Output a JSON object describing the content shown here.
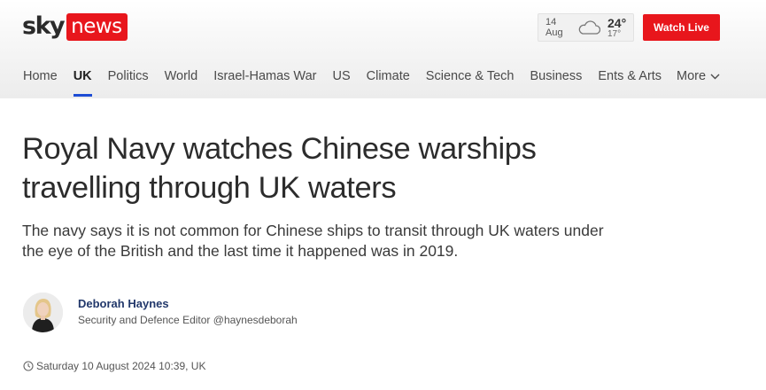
{
  "brand": {
    "logo_sky": "sky",
    "logo_news": "news",
    "accent": "#e8161c"
  },
  "weather": {
    "date": "14 Aug",
    "icon": "cloud-icon",
    "high": "24°",
    "low": "17°"
  },
  "header": {
    "watch_live": "Watch Live"
  },
  "nav": {
    "items": [
      {
        "label": "Home"
      },
      {
        "label": "UK",
        "active": true
      },
      {
        "label": "Politics"
      },
      {
        "label": "World"
      },
      {
        "label": "Israel-Hamas War"
      },
      {
        "label": "US"
      },
      {
        "label": "Climate"
      },
      {
        "label": "Science & Tech"
      },
      {
        "label": "Business"
      },
      {
        "label": "Ents & Arts"
      }
    ],
    "more_label": "More",
    "active_color": "#1d4cd4"
  },
  "article": {
    "headline": "Royal Navy watches Chinese warships travelling through UK waters",
    "standfirst": "The navy says it is not common for Chinese ships to transit through UK waters under the eye of the British and the last time it happened was in 2019.",
    "author": {
      "name": "Deborah Haynes",
      "role": "Security and Defence Editor",
      "handle": "@haynesdeborah",
      "name_color": "#22386b"
    },
    "published": "Saturday 10 August 2024 10:39, UK"
  }
}
